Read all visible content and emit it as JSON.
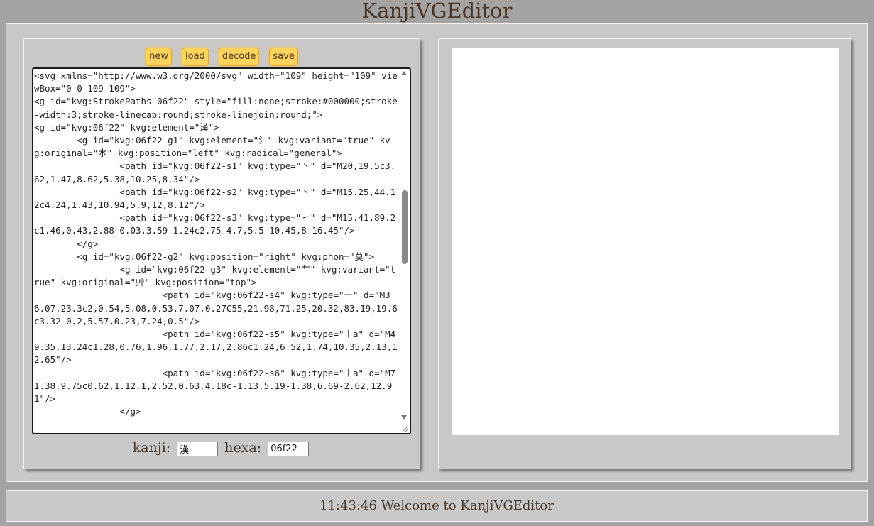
{
  "app": {
    "title": "KanjiVGEditor"
  },
  "toolbar": {
    "new_label": "new",
    "load_label": "load",
    "decode_label": "decode",
    "save_label": "save"
  },
  "editor": {
    "code": "<svg xmlns=\"http://www.w3.org/2000/svg\" width=\"109\" height=\"109\" viewBox=\"0 0 109 109\">\n<g id=\"kvg:StrokePaths_06f22\" style=\"fill:none;stroke:#000000;stroke-width:3;stroke-linecap:round;stroke-linejoin:round;\">\n<g id=\"kvg:06f22\" kvg:element=\"漢\">\n        <g id=\"kvg:06f22-g1\" kvg:element=\"氵\" kvg:variant=\"true\" kvg:original=\"水\" kvg:position=\"left\" kvg:radical=\"general\">\n                <path id=\"kvg:06f22-s1\" kvg:type=\"㇔\" d=\"M20,19.5c3.62,1.47,8.62,5.38,10.25,8.34\"/>\n                <path id=\"kvg:06f22-s2\" kvg:type=\"㇔\" d=\"M15.25,44.12c4.24,1.43,10.94,5.9,12,8.12\"/>\n                <path id=\"kvg:06f22-s3\" kvg:type=\"㇀\" d=\"M15.41,89.2c1.46,0.43,2.88-0.03,3.59-1.24c2.75-4.7,5.5-10.45,8-16.45\"/>\n        </g>\n        <g id=\"kvg:06f22-g2\" kvg:position=\"right\" kvg:phon=\"莫\">\n                <g id=\"kvg:06f22-g3\" kvg:element=\"艹\" kvg:variant=\"true\" kvg:original=\"艸\" kvg:position=\"top\">\n                        <path id=\"kvg:06f22-s4\" kvg:type=\"㇐\" d=\"M36.07,23.3c2,0.54,5.08,0.53,7.07,0.27C55,21.98,71.25,20.32,83.19,19.6c3.32-0.2,5.57,0.23,7.24,0.5\"/>\n                        <path id=\"kvg:06f22-s5\" kvg:type=\"㇑a\" d=\"M49.35,13.24c1.28,0.76,1.96,1.77,2.17,2.86c1.24,6.52,1.74,10.35,2.13,12.65\"/>\n                        <path id=\"kvg:06f22-s6\" kvg:type=\"㇑a\" d=\"M71.38,9.75c0.62,1.12,1,2.52,0.63,4.18c-1.13,5.19-1.38,6.69-2.62,12.91\"/>\n                </g>"
  },
  "kanji_row": {
    "kanji_label": "kanji:",
    "kanji_value": "漢",
    "hexa_label": "hexa:",
    "hexa_value": "06f22"
  },
  "status": {
    "message": "11:43:46 Welcome to KanjiVGEditor"
  }
}
